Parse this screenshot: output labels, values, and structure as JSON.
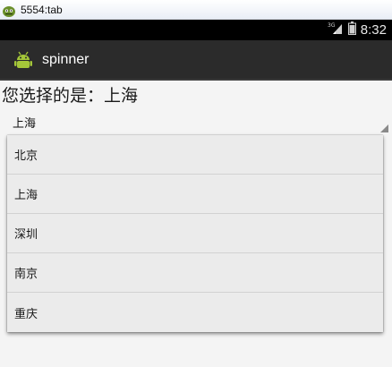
{
  "window": {
    "title": "5554:tab",
    "icon": "android-emulator-icon"
  },
  "statusbar": {
    "network": "3G",
    "time": "8:32",
    "icons": [
      "signal-icon",
      "battery-icon"
    ]
  },
  "actionbar": {
    "app_icon": "android-icon",
    "title": "spinner"
  },
  "content": {
    "result_text": "您选择的是：上海"
  },
  "spinner": {
    "selected_value": "上海",
    "options": [
      {
        "label": "北京"
      },
      {
        "label": "上海"
      },
      {
        "label": "深圳"
      },
      {
        "label": "南京"
      },
      {
        "label": "重庆"
      }
    ]
  },
  "colors": {
    "statusbar_bg": "#000000",
    "actionbar_bg": "#2b2b2b",
    "content_bg": "#f4f4f4",
    "dropdown_bg": "#ebebeb"
  }
}
